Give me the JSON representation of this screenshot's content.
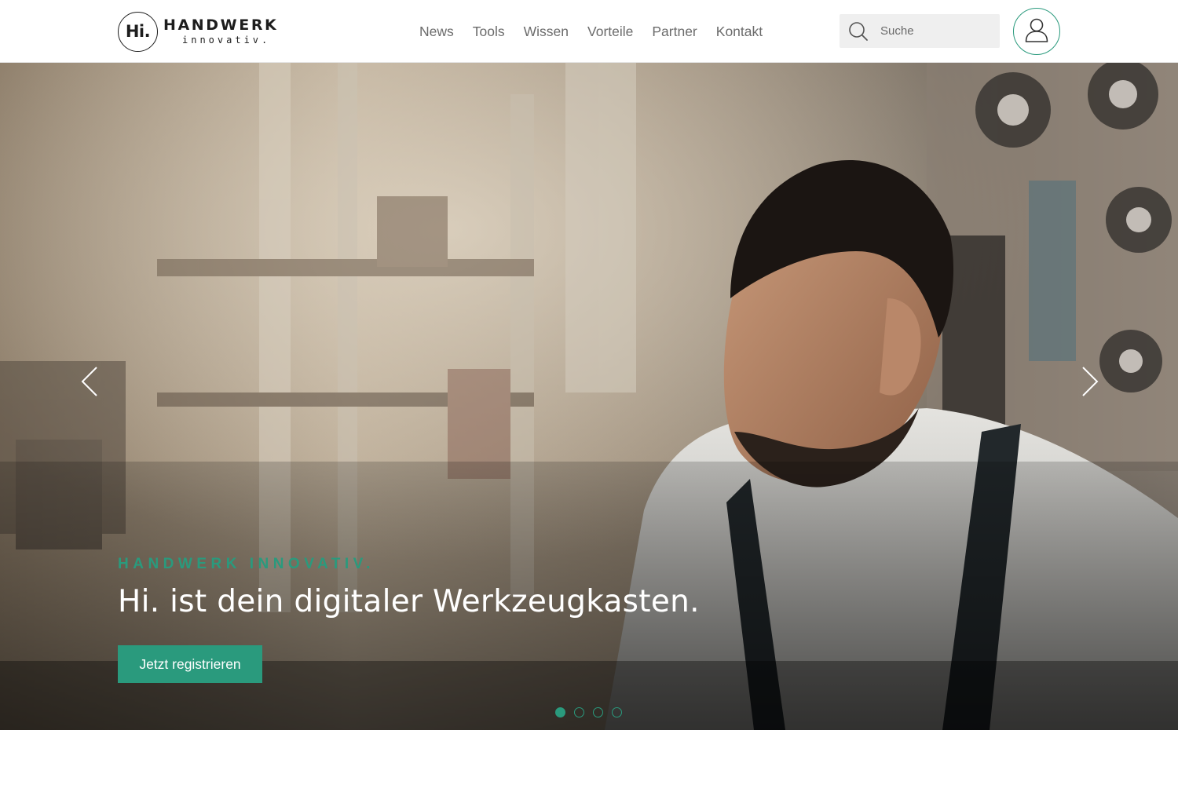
{
  "brand": {
    "badge": "Hi.",
    "title": "HANDWERK",
    "subtitle": "innovativ."
  },
  "nav": {
    "items": [
      {
        "label": "News"
      },
      {
        "label": "Tools"
      },
      {
        "label": "Wissen"
      },
      {
        "label": "Vorteile"
      },
      {
        "label": "Partner"
      },
      {
        "label": "Kontakt"
      }
    ]
  },
  "search": {
    "placeholder": "Suche",
    "icon": "search-icon"
  },
  "user": {
    "icon": "user-icon"
  },
  "hero": {
    "eyebrow": "HANDWERK INNOVATIV.",
    "title": "Hi. ist dein digitaler Werkzeugkasten.",
    "cta_label": "Jetzt registrieren",
    "prev_icon": "chevron-left-icon",
    "next_icon": "chevron-right-icon",
    "slides_total": 4,
    "active_slide": 1
  },
  "colors": {
    "accent": "#2a9a7d",
    "text_dark": "#1d1d1d",
    "nav_text": "#6b6b6b",
    "search_bg": "#efefef"
  }
}
